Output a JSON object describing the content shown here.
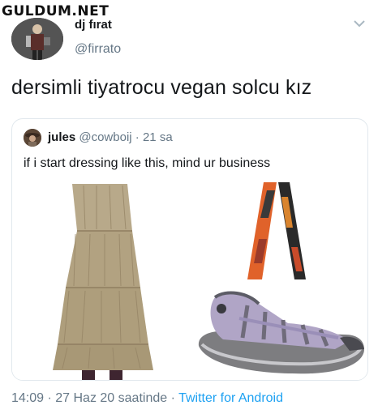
{
  "watermark": "GULDUM.NET",
  "tweet": {
    "display_name": "dj fırat",
    "handle": "@firrato",
    "text": "dersimli tiyatrocu vegan solcu kız"
  },
  "quote": {
    "display_name": "jules",
    "handle": "@cowboij",
    "separator": "·",
    "time": "21 sa",
    "text": "if i start dressing like this, mind ur business",
    "images": [
      "tiered-skirt-image",
      "strap-image",
      "sandal-image"
    ]
  },
  "footer": {
    "timestamp": "14:09 · 27 Haz 20 saatinde ·",
    "source": "Twitter for Android"
  },
  "colors": {
    "link": "#1da1f2",
    "secondary_text": "#657786",
    "border": "#e1e8ed"
  },
  "icons": [
    "chevron-down-icon"
  ]
}
